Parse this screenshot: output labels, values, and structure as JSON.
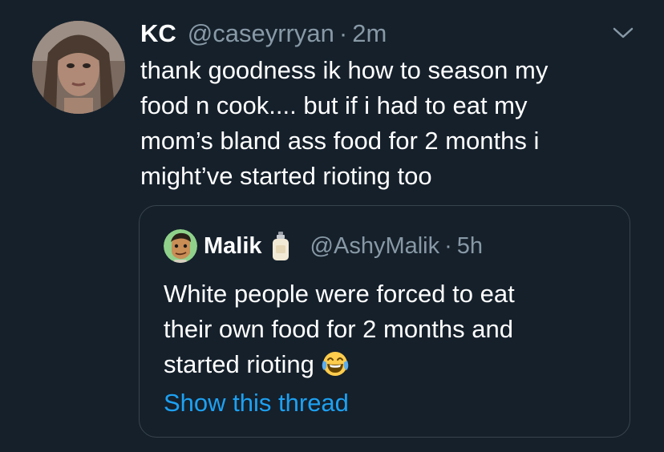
{
  "tweet": {
    "name": "KC",
    "handle": "@caseyrryan",
    "separator": "·",
    "time": "2m",
    "text_lines": [
      "thank goodness ik how to season my",
      "food n cook.... but if i had to eat my",
      "mom’s bland ass food for 2 months i",
      "might’ve started rioting too"
    ]
  },
  "quoted_tweet": {
    "name": "Malik",
    "handle": "@AshyMalik",
    "separator": "·",
    "time": "5h",
    "text_lines": [
      "White people were forced to eat",
      "their own food for 2 months and",
      "started rioting"
    ],
    "emoji": "face-with-tears-of-joy",
    "name_emoji": "lotion-bottle",
    "show_thread": "Show this thread"
  },
  "colors": {
    "background": "#15202b",
    "secondary_text": "#8899a6",
    "link": "#1da1f2",
    "border": "#38444d"
  }
}
